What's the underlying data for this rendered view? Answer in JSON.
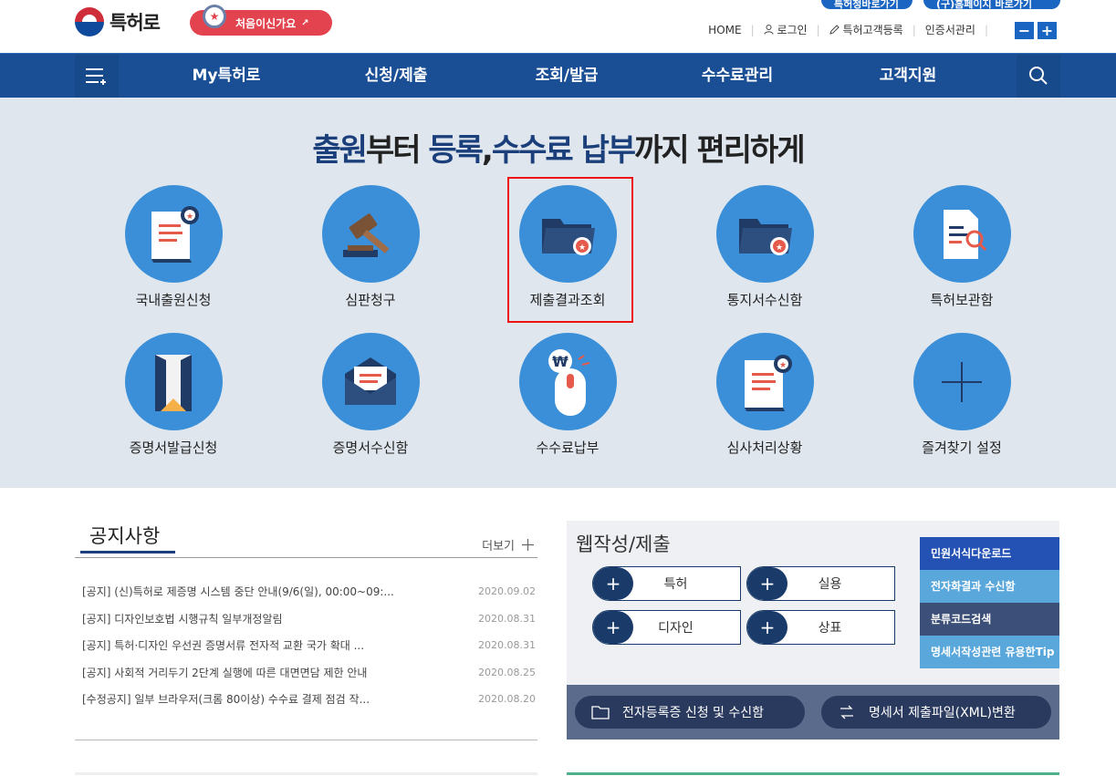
{
  "header": {
    "logo_text": "특허로",
    "first_visit_label": "처음이신가요",
    "top_pills": [
      "특허청바로가기",
      "(구)홈페이지 바로가기"
    ],
    "util_links": [
      "HOME",
      "로그인",
      "특허고객등록",
      "인증서관리"
    ],
    "zoom_out": "−",
    "zoom_in": "+"
  },
  "nav": {
    "items": [
      "My특허로",
      "신청/제출",
      "조회/발급",
      "수수료관리",
      "고객지원"
    ]
  },
  "hero": {
    "title_parts": [
      "출원",
      "부터 ",
      "등록",
      ",",
      "수수료 납부",
      "까지 편리하게"
    ],
    "services": [
      {
        "label": "국내출원신청",
        "icon": "document-badge-icon"
      },
      {
        "label": "심판청구",
        "icon": "gavel-icon"
      },
      {
        "label": "제출결과조회",
        "icon": "folder-badge-icon"
      },
      {
        "label": "통지서수신함",
        "icon": "folder-badge-icon"
      },
      {
        "label": "특허보관함",
        "icon": "document-search-icon"
      },
      {
        "label": "증명서발급신청",
        "icon": "envelope-open-icon"
      },
      {
        "label": "증명서수신함",
        "icon": "envelope-letter-icon"
      },
      {
        "label": "수수료납부",
        "icon": "mouse-won-icon"
      },
      {
        "label": "심사처리상황",
        "icon": "document-badge-icon"
      },
      {
        "label": "즐겨찾기 설정",
        "icon": "plus-icon"
      }
    ]
  },
  "notice": {
    "title": "공지사항",
    "more_label": "더보기",
    "items": [
      {
        "text": "[공지] (신)특허로 제증명 시스템 중단 안내(9/6(일), 00:00~09:...",
        "date": "2020.09.02"
      },
      {
        "text": "[공지] 디자인보호법 시행규칙 일부개정알림",
        "date": "2020.08.31"
      },
      {
        "text": "[공지] 특허·디자인 우선권 증명서류 전자적 교환 국가 확대 ...",
        "date": "2020.08.31"
      },
      {
        "text": "[공지] 사회적 거리두기 2단계 실행에 따른 대면면담 제한 안내",
        "date": "2020.08.25"
      },
      {
        "text": "[수정공지] 일부 브라우저(크롬 80이상) 수수료 결제 점검 작...",
        "date": "2020.08.20"
      }
    ]
  },
  "web": {
    "title": "웹작성/제출",
    "buttons": [
      "특허",
      "실용",
      "디자인",
      "상표"
    ],
    "side_menu": [
      {
        "label": "민원서식다운로드",
        "color": "#2451b4"
      },
      {
        "label": "전자화결과 수신함",
        "color": "#5aa7dc"
      },
      {
        "label": "분류코드검색",
        "color": "#3b4f78"
      },
      {
        "label": "명세서작성관련 유용한Tip",
        "color": "#5aa7dc"
      }
    ],
    "footer": [
      "전자등록증 신청 및 수신함",
      "명세서 제출파일(XML)변환"
    ]
  },
  "colors": {
    "nav": "#1a4f96",
    "accent": "#1b65c2",
    "hero_bg": "#dfe6ed",
    "circle": "#3a8fd8",
    "highlight": "#e11111"
  }
}
